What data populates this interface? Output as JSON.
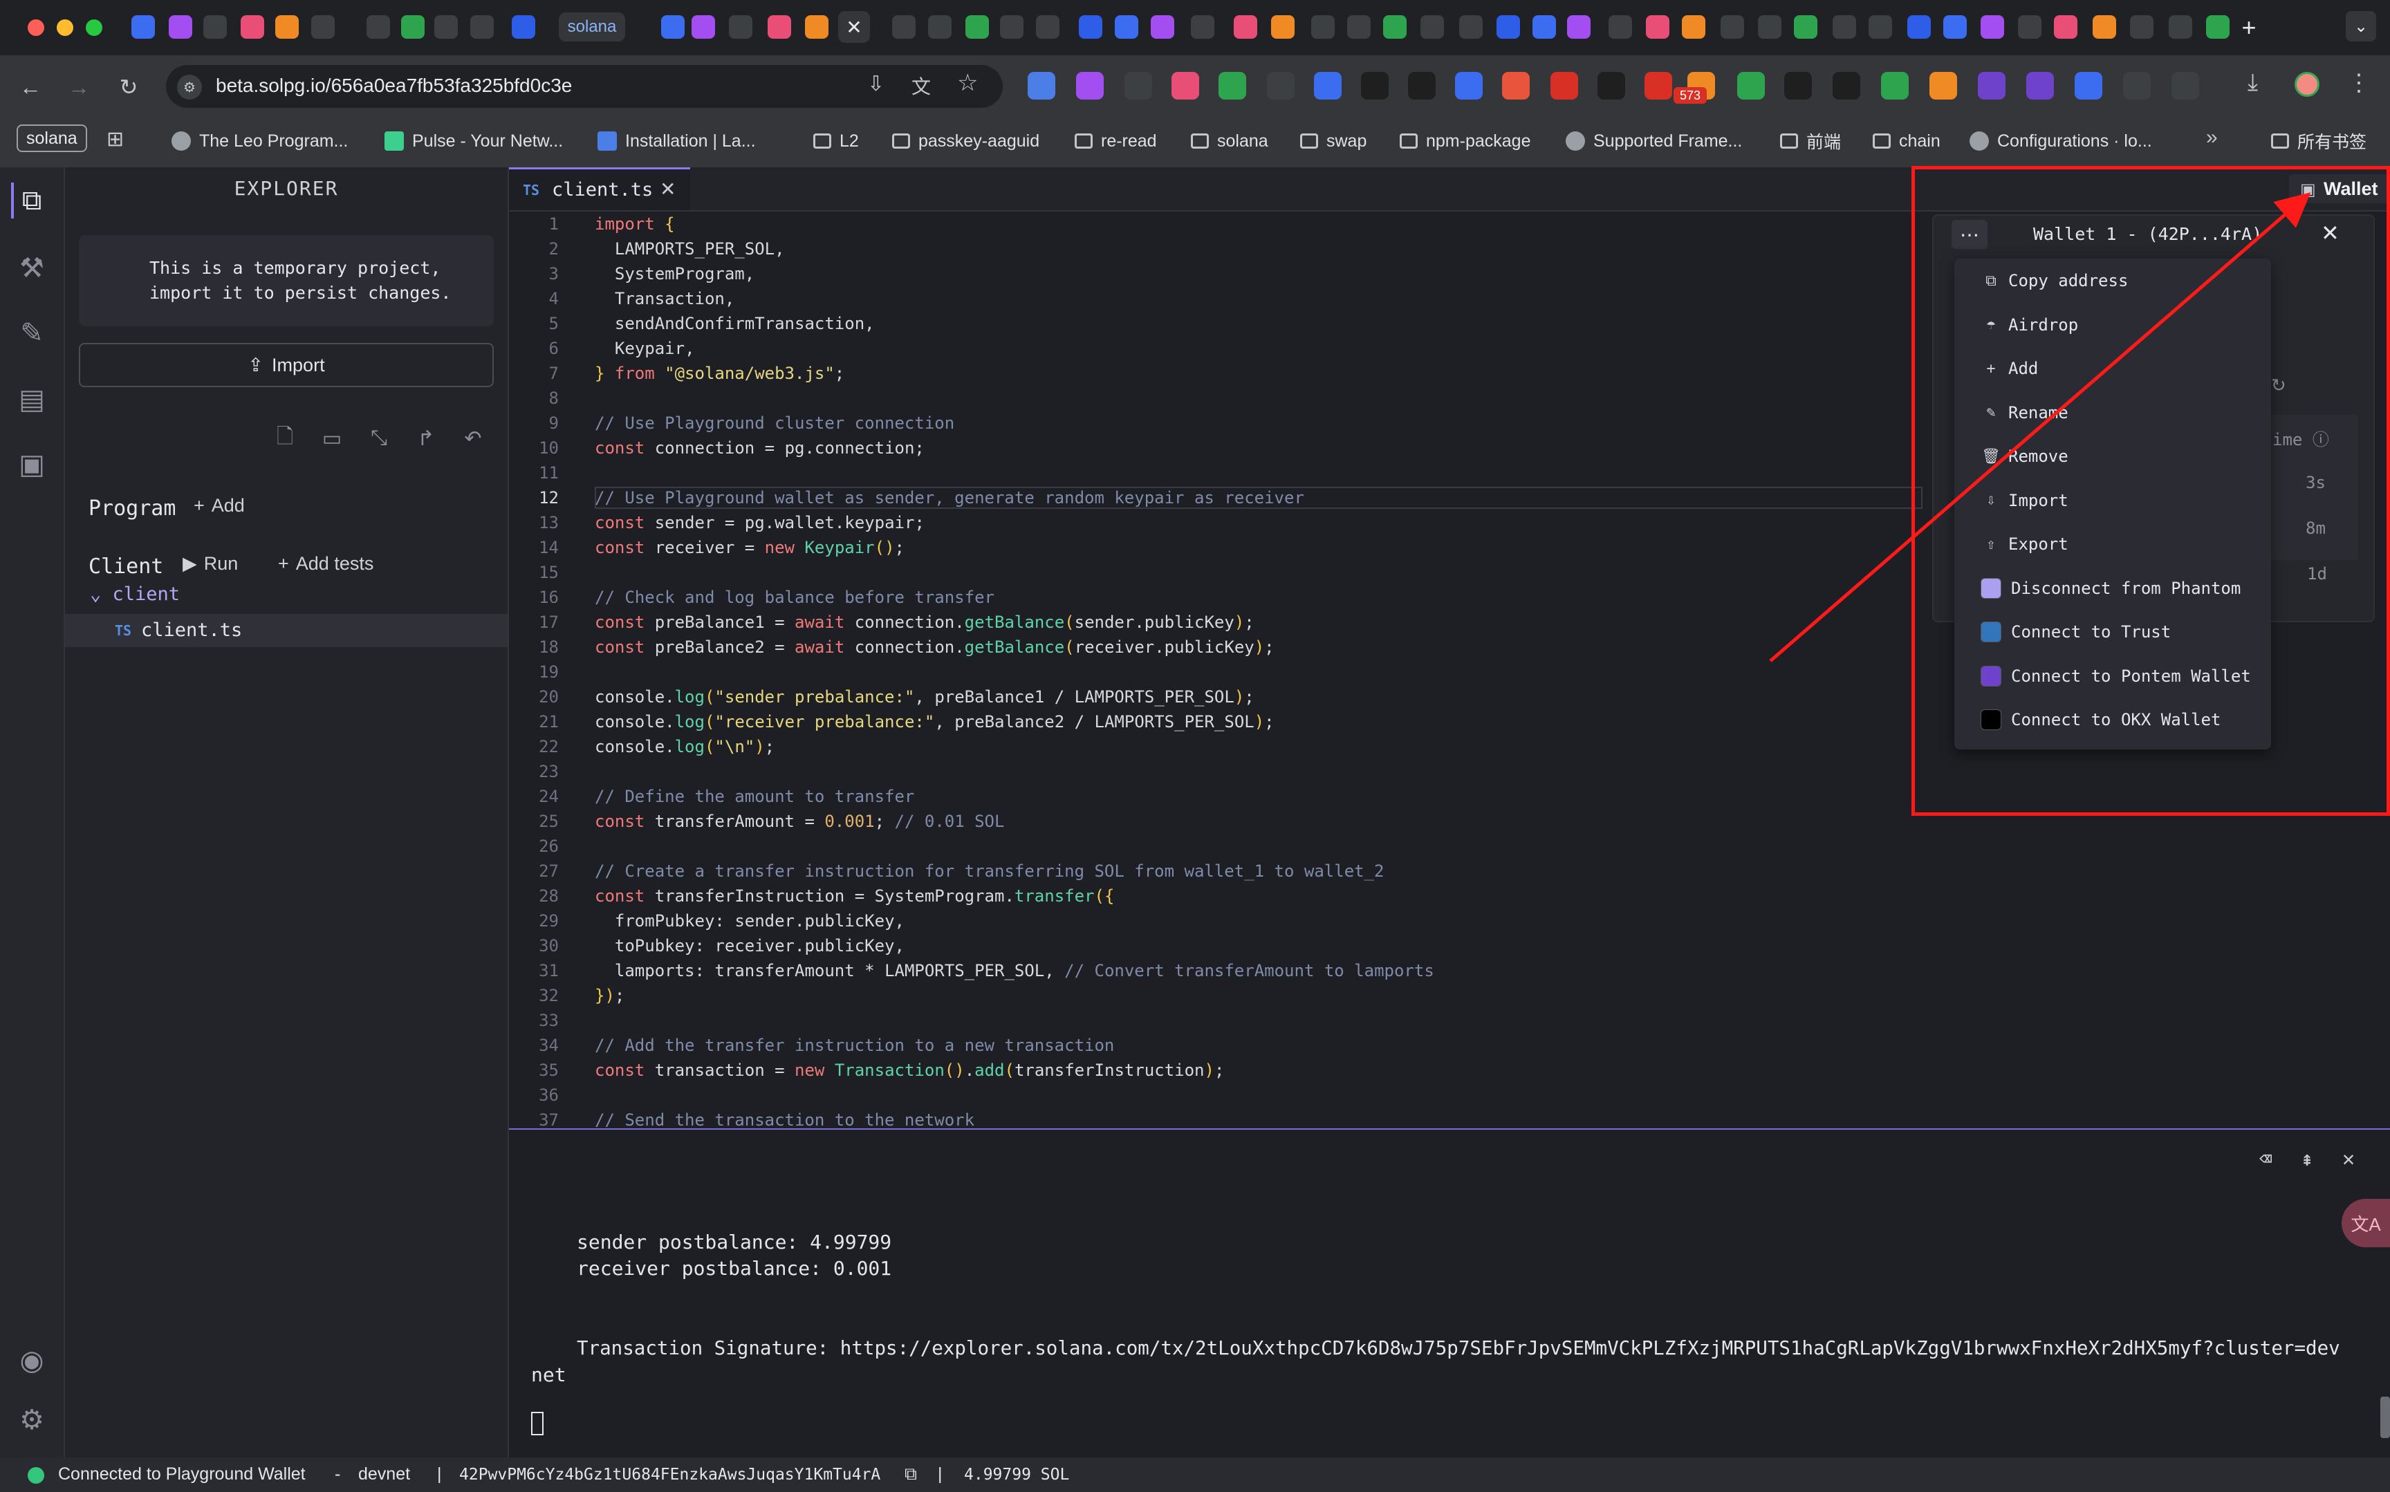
{
  "browser": {
    "active_tab_label": "solana",
    "url": "beta.solpg.io/656a0ea7fb53fa325bfd0c3e",
    "extension_badge": "573",
    "bookmarks": [
      {
        "label": "solana",
        "type": "pill"
      },
      {
        "label": "The Leo Program...",
        "type": "site"
      },
      {
        "label": "Pulse - Your Netw...",
        "type": "site"
      },
      {
        "label": "Installation | La...",
        "type": "site"
      },
      {
        "label": "L2",
        "type": "folder"
      },
      {
        "label": "passkey-aaguid",
        "type": "folder"
      },
      {
        "label": "re-read",
        "type": "folder"
      },
      {
        "label": "solana",
        "type": "folder"
      },
      {
        "label": "swap",
        "type": "folder"
      },
      {
        "label": "npm-package",
        "type": "folder"
      },
      {
        "label": "Supported Frame...",
        "type": "site"
      },
      {
        "label": "前端",
        "type": "folder"
      },
      {
        "label": "chain",
        "type": "folder"
      },
      {
        "label": "Configurations · lo...",
        "type": "site"
      },
      {
        "label": "所有书签",
        "type": "folder"
      }
    ]
  },
  "sidebar": {
    "title": "EXPLORER",
    "notice": "This is a temporary project, import it to persist changes.",
    "import_label": "Import",
    "program_label": "Program",
    "add_label": "Add",
    "client_label": "Client",
    "run_label": "Run",
    "add_tests_label": "Add tests",
    "folder_name": "client",
    "file_name": "client.ts",
    "file_type": "TS"
  },
  "editor": {
    "tab_label": "client.ts",
    "tab_type": "TS",
    "lines": [
      "import {",
      "  LAMPORTS_PER_SOL,",
      "  SystemProgram,",
      "  Transaction,",
      "  sendAndConfirmTransaction,",
      "  Keypair,",
      "} from \"@solana/web3.js\";",
      "",
      "// Use Playground cluster connection",
      "const connection = pg.connection;",
      "",
      "// Use Playground wallet as sender, generate random keypair as receiver",
      "const sender = pg.wallet.keypair;",
      "const receiver = new Keypair();",
      "",
      "// Check and log balance before transfer",
      "const preBalance1 = await connection.getBalance(sender.publicKey);",
      "const preBalance2 = await connection.getBalance(receiver.publicKey);",
      "",
      "console.log(\"sender prebalance:\", preBalance1 / LAMPORTS_PER_SOL);",
      "console.log(\"receiver prebalance:\", preBalance2 / LAMPORTS_PER_SOL);",
      "console.log(\"\\n\");",
      "",
      "// Define the amount to transfer",
      "const transferAmount = 0.001; // 0.01 SOL",
      "",
      "// Create a transfer instruction for transferring SOL from wallet_1 to wallet_2",
      "const transferInstruction = SystemProgram.transfer({",
      "  fromPubkey: sender.publicKey,",
      "  toPubkey: receiver.publicKey,",
      "  lamports: transferAmount * LAMPORTS_PER_SOL, // Convert transferAmount to lamports",
      "});",
      "",
      "// Add the transfer instruction to a new transaction",
      "const transaction = new Transaction().add(transferInstruction);",
      "",
      "// Send the transaction to the network"
    ]
  },
  "terminal": {
    "line1": "sender postbalance: 4.99799",
    "line2": "receiver postbalance: 0.001",
    "signature_line": "Transaction Signature: https://explorer.solana.com/tx/2tLouXxthpcCD7k6D8wJ75p7SEbFrJpvSEMmVCkPLZfXzjMRPUTS1haCgRLapVkZggV1brwwxFnxHeXr2dHX5myf?cluster=dev",
    "signature_wrap": "net"
  },
  "wallet": {
    "button_label": "Wallet",
    "title": "Wallet 1 - (42P...4rA)",
    "time_header": "ime",
    "times": [
      "3s",
      "8m",
      "1d"
    ],
    "menu": [
      {
        "label": "Copy address",
        "icon": "copy-icon"
      },
      {
        "label": "Airdrop",
        "icon": "airdrop-icon"
      },
      {
        "label": "Add",
        "icon": "plus-icon"
      },
      {
        "label": "Rename",
        "icon": "pencil-icon"
      },
      {
        "label": "Remove",
        "icon": "trash-icon"
      },
      {
        "label": "Import",
        "icon": "import-icon"
      },
      {
        "label": "Export",
        "icon": "export-icon"
      },
      {
        "label": "Disconnect from Phantom",
        "icon": "phantom-icon",
        "color": "#ab9ff2"
      },
      {
        "label": "Connect to Trust",
        "icon": "trust-icon",
        "color": "#3375bb"
      },
      {
        "label": "Connect to Pontem Wallet",
        "icon": "pontem-icon",
        "color": "#6e42ca"
      },
      {
        "label": "Connect to OKX Wallet",
        "icon": "okx-icon",
        "color": "#000000"
      }
    ]
  },
  "status": {
    "connection": "Connected to Playground Wallet",
    "sep1": "-",
    "network": "devnet",
    "sep2": "|",
    "address": "42PwvPM6cYz4bGz1tU684FEnzkaAwsJuqasY1KmTu4rA",
    "sep3": "|",
    "balance": "4.99799 SOL"
  },
  "colors": {
    "accent": "#8a7cf0",
    "status_ok": "#34c77b",
    "annotation": "#ff1a1a"
  }
}
